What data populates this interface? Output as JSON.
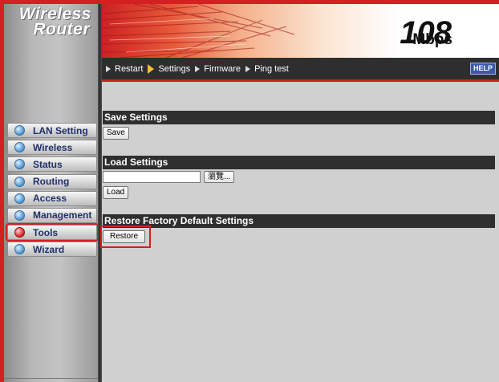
{
  "brand": {
    "line1": "Wireless",
    "line2": "Router"
  },
  "banner": {
    "speed": "108",
    "unit": "Mbps"
  },
  "menu": {
    "items": [
      {
        "label": "Restart",
        "active": false
      },
      {
        "label": "Settings",
        "active": true
      },
      {
        "label": "Firmware",
        "active": false
      },
      {
        "label": "Ping test",
        "active": false
      }
    ],
    "help_label": "HELP"
  },
  "sidebar": {
    "items": [
      {
        "label": "LAN Setting",
        "active": false
      },
      {
        "label": "Wireless",
        "active": false
      },
      {
        "label": "Status",
        "active": false
      },
      {
        "label": "Routing",
        "active": false
      },
      {
        "label": "Access",
        "active": false
      },
      {
        "label": "Management",
        "active": false
      },
      {
        "label": "Tools",
        "active": true
      },
      {
        "label": "Wizard",
        "active": false
      }
    ]
  },
  "sections": {
    "save": {
      "title": "Save Settings",
      "button": "Save"
    },
    "load": {
      "title": "Load Settings",
      "file_value": "",
      "browse_button": "瀏覽...",
      "button": "Load"
    },
    "restore": {
      "title": "Restore Factory Default Settings",
      "button": "Restore"
    }
  },
  "colors": {
    "accent": "#d42020",
    "menubar": "#2e2e2e",
    "section_bar": "#2f2f2f",
    "content_bg": "#d0d0d0"
  }
}
